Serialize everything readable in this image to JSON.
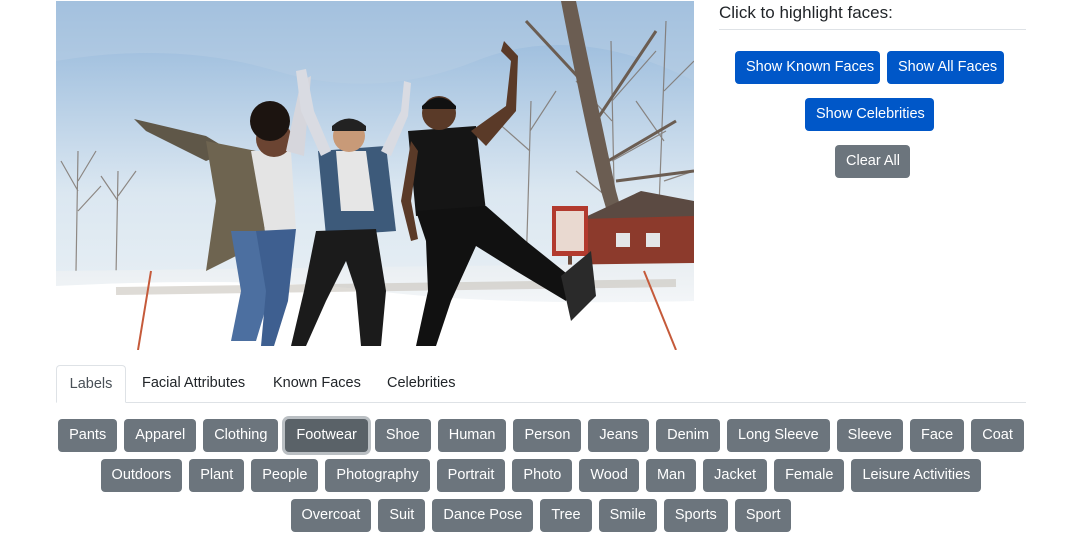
{
  "image": {
    "alt": ""
  },
  "right_panel": {
    "title": "Click to highlight faces:",
    "buttons": {
      "known_faces": "Show Known Faces",
      "all_faces": "Show All Faces",
      "celebrities": "Show Celebrities",
      "clear_all": "Clear All"
    }
  },
  "tabs": [
    {
      "label": "Labels",
      "active": true
    },
    {
      "label": "Facial Attributes",
      "active": false
    },
    {
      "label": "Known Faces",
      "active": false
    },
    {
      "label": "Celebrities",
      "active": false
    }
  ],
  "labels": {
    "row1": [
      "Pants",
      "Apparel",
      "Clothing",
      "Footwear",
      "Shoe",
      "Human",
      "Person",
      "Jeans",
      "Denim",
      "Long Sleeve",
      "Sleeve",
      "Face",
      "Coat"
    ],
    "row2": [
      "Outdoors",
      "Plant",
      "People",
      "Photography",
      "Portrait",
      "Photo",
      "Wood",
      "Man",
      "Jacket",
      "Female",
      "Leisure Activities"
    ],
    "row3": [
      "Overcoat",
      "Suit",
      "Dance Pose",
      "Tree",
      "Smile",
      "Sports",
      "Sport"
    ],
    "focused": "Footwear"
  },
  "colors": {
    "primary": "#0057c8",
    "secondary": "#6c757d",
    "border": "#dee2e6"
  }
}
